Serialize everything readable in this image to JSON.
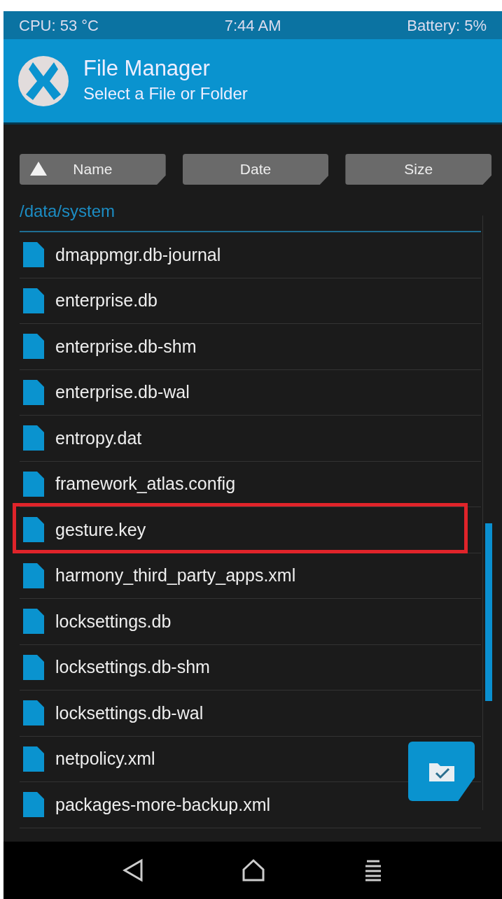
{
  "status_bar": {
    "cpu": "CPU: 53 °C",
    "time": "7:44 AM",
    "battery": "Battery: 5%"
  },
  "header": {
    "title": "File Manager",
    "subtitle": "Select a File or Folder"
  },
  "sort_buttons": [
    {
      "label": "Name",
      "selected": true
    },
    {
      "label": "Date",
      "selected": false
    },
    {
      "label": "Size",
      "selected": false
    }
  ],
  "path": "/data/system",
  "files": [
    {
      "name": "dmappmgr.db-journal",
      "highlighted": false
    },
    {
      "name": "enterprise.db",
      "highlighted": false
    },
    {
      "name": "enterprise.db-shm",
      "highlighted": false
    },
    {
      "name": "enterprise.db-wal",
      "highlighted": false
    },
    {
      "name": "entropy.dat",
      "highlighted": false
    },
    {
      "name": "framework_atlas.config",
      "highlighted": false
    },
    {
      "name": "gesture.key",
      "highlighted": true
    },
    {
      "name": "harmony_third_party_apps.xml",
      "highlighted": false
    },
    {
      "name": "locksettings.db",
      "highlighted": false
    },
    {
      "name": "locksettings.db-shm",
      "highlighted": false
    },
    {
      "name": "locksettings.db-wal",
      "highlighted": false
    },
    {
      "name": "netpolicy.xml",
      "highlighted": false
    },
    {
      "name": "packages-more-backup.xml",
      "highlighted": false
    }
  ]
}
